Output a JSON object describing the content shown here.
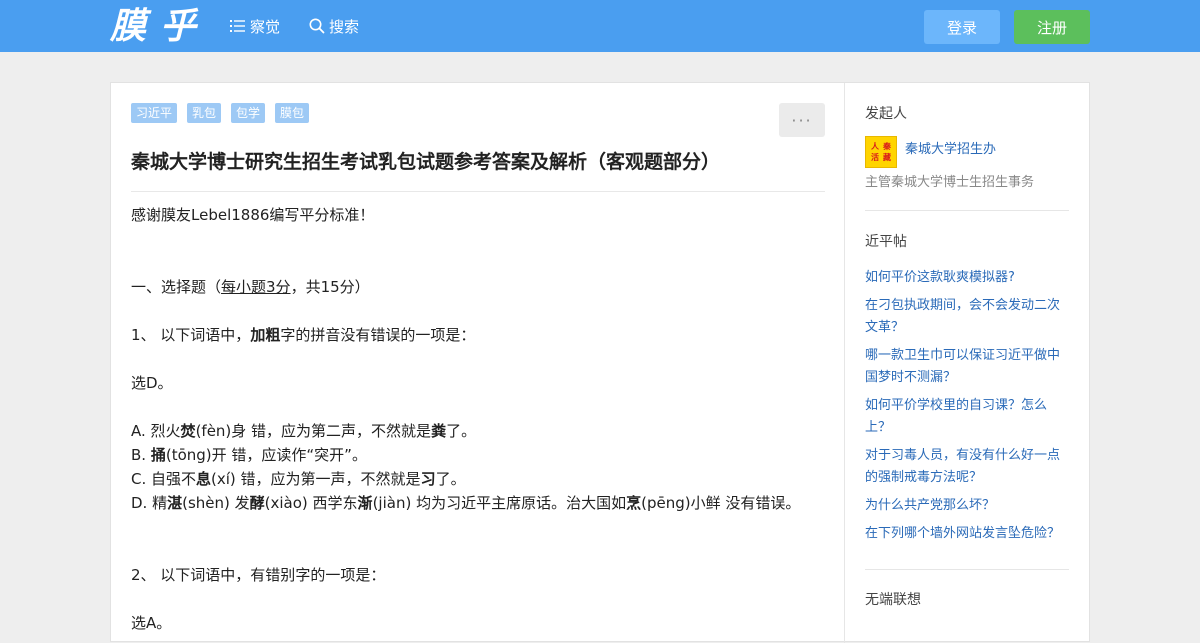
{
  "header": {
    "logo": "膜乎",
    "nav_explore": "察觉",
    "nav_search": "搜索",
    "login": "登录",
    "register": "注册"
  },
  "question": {
    "tags": [
      "习近平",
      "乳包",
      "包学",
      "膜包"
    ],
    "more": "···",
    "title": "秦城大学博士研究生招生考试乳包试题参考答案及解析（客观题部分）"
  },
  "content": {
    "thanks": "感谢膜友Lebel1886编写平分标准！",
    "section_prefix": "一、选择题（",
    "section_underline": "每小题3分",
    "section_suffix": "，共15分）",
    "q1_prefix": "1、 以下词语中，",
    "q1_bold": "加粗",
    "q1_suffix": "字的拼音没有错误的一项是：",
    "q1_answer": "选D。",
    "optA_1": "A. 烈火",
    "optA_b1": "焚",
    "optA_2": "(fèn)身 错，应为第二声，不然就是",
    "optA_b2": "粪",
    "optA_3": "了。",
    "optB_1": "B. ",
    "optB_b1": "捅",
    "optB_2": "(tōng)开 错，应读作“突开”。",
    "optC_1": "C. 自强不",
    "optC_b1": "息",
    "optC_2": "(xí) 错，应为第一声，不然就是",
    "optC_b2": "习",
    "optC_3": "了。",
    "optD_1": "D. 精",
    "optD_b1": "湛",
    "optD_2": "(shèn) 发",
    "optD_b2": "酵",
    "optD_3": "(xiào) 西学东",
    "optD_b3": "渐",
    "optD_4": "(jiàn) 均为习近平主席原话。治大国如",
    "optD_b4": "烹",
    "optD_5": "(pēng)小鲜 没有错误。",
    "q2": "2、 以下词语中，有错别字的一项是：",
    "q2_answer": "选A。"
  },
  "sidebar": {
    "initiator_heading": "发起人",
    "avatar_text": [
      "人",
      "秦",
      "活",
      "藏"
    ],
    "author_name": "秦城大学招生办",
    "author_desc": "主管秦城大学博士生招生事务",
    "hot_heading": "近平帖",
    "hot_items": [
      "如何平价这款耿爽模拟器?",
      "在刁包执政期间，会不会发动二次文革？",
      "哪一款卫生巾可以保证习近平做中国梦时不测漏？",
      "如何平价学校里的自习课？怎么上？",
      "对于习毒人员，有没有什么好一点的强制戒毒方法呢？",
      "为什么共产党那么坏？",
      "在下列哪个墙外网站发言坠危险？"
    ],
    "related_heading": "无端联想"
  },
  "colors": {
    "header_bg": "#4a9ef0",
    "login_bg": "#6cb6fb",
    "register_bg": "#5cbf5c",
    "tag_bg": "#9dc9f5",
    "link": "#2a6ab8"
  },
  "icons": {
    "explore": "list-icon",
    "search": "search-icon"
  }
}
